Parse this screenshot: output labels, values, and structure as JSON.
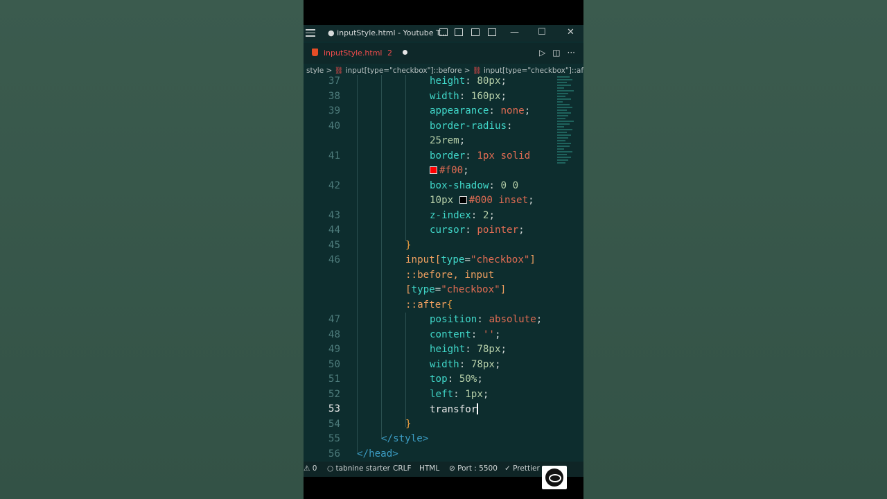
{
  "titlebar": {
    "title": "● inputStyle.html - Youtube T...",
    "minimize": "—",
    "maximize": "☐",
    "close": "✕"
  },
  "tab": {
    "label": "inputStyle.html",
    "problems": "2"
  },
  "tab_actions": {
    "run": "▷",
    "split": "◫",
    "more": "···"
  },
  "breadcrumb": {
    "root": "style",
    "item1": "input[type=\"checkbox\"]::before",
    "item2": "input[type=\"checkbox\"]::after",
    "sep": ">"
  },
  "code": {
    "line_numbers": [
      "37",
      "38",
      "39",
      "40",
      "41",
      "42",
      "43",
      "44",
      "45",
      "46",
      "47",
      "48",
      "49",
      "50",
      "51",
      "52",
      "53",
      "54",
      "55",
      "56"
    ],
    "l37": {
      "prop": "height",
      "val": "80px"
    },
    "l38": {
      "prop": "width",
      "val": "160px"
    },
    "l39": {
      "prop": "appearance",
      "val": "none"
    },
    "l40a": {
      "prop": "border-radius"
    },
    "l40b": {
      "val": "25rem"
    },
    "l41a": {
      "prop": "border",
      "val": "1px solid"
    },
    "l41b": {
      "val": "#f00"
    },
    "l42a": {
      "prop": "box-shadow",
      "val": "0 0"
    },
    "l42b": {
      "val1": "10px",
      "val2": "#000 inset"
    },
    "l43": {
      "prop": "z-index",
      "val": "2"
    },
    "l44": {
      "prop": "cursor",
      "val": "pointer"
    },
    "l45": "}",
    "l46a": {
      "sel": "input",
      "attr": "type",
      "str": "\"checkbox\""
    },
    "l46b": {
      "pseudo": "::before, input"
    },
    "l46c": {
      "attr": "type",
      "str": "\"checkbox\""
    },
    "l46d": {
      "pseudo": "::after"
    },
    "l47": {
      "prop": "position",
      "val": "absolute"
    },
    "l48": {
      "prop": "content",
      "val": "''"
    },
    "l49": {
      "prop": "height",
      "val": "78px"
    },
    "l50": {
      "prop": "width",
      "val": "78px"
    },
    "l51": {
      "prop": "top",
      "val": "50%"
    },
    "l52": {
      "prop": "left",
      "val": "1px"
    },
    "l53": {
      "text": "transfor"
    },
    "l54": "}",
    "l55": "</style>",
    "l56": "</head>",
    "swatch_red": "#ff0000",
    "swatch_black": "#000000"
  },
  "statusbar": {
    "errors": "⚠ 0",
    "tabnine": "○ tabnine starter",
    "eol": "CRLF",
    "lang": "HTML",
    "port": "⊘ Port : 5500",
    "prettier": "✓ Prettier"
  }
}
